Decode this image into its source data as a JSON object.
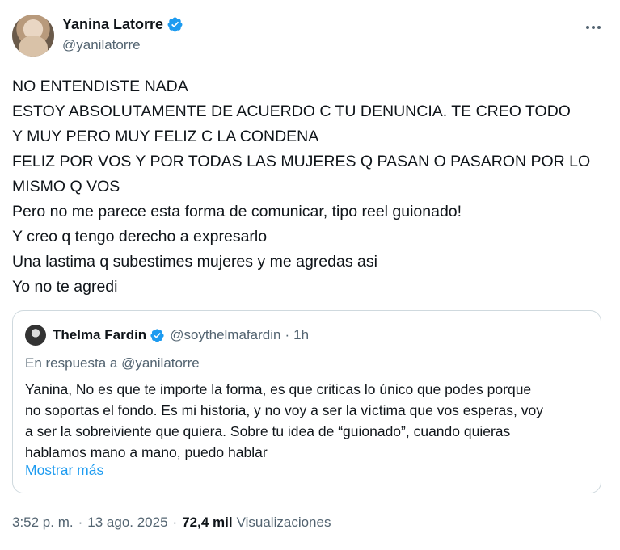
{
  "author": {
    "name": "Yanina Latorre",
    "handle": "@yanilatorre"
  },
  "tweet": {
    "lines": [
      "NO ENTENDISTE NADA",
      "ESTOY ABSOLUTAMENTE DE ACUERDO C TU DENUNCIA. TE CREO TODO",
      "Y MUY PERO MUY FELIZ C LA CONDENA",
      "FELIZ POR VOS Y POR TODAS LAS MUJERES Q PASAN O PASARON POR LO",
      "MISMO Q VOS",
      "Pero no me parece esta forma de comunicar, tipo reel guionado!",
      "Y creo q tengo derecho a expresarlo",
      "Una lastima q subestimes mujeres y me agredas asi",
      "Yo no te agredi"
    ]
  },
  "quote": {
    "name": "Thelma Fardin",
    "handle": "@soythelmafardin",
    "separator": "·",
    "time": "1h",
    "reply_prefix": "En respuesta a",
    "reply_to": "@yanilatorre",
    "lines": [
      "Yanina, No es que te importe la forma, es que criticas lo único que podes porque",
      "no soportas el fondo. Es mi historia, y no voy a ser la víctima que vos esperas, voy",
      "a ser la sobreiviente que quiera. Sobre tu idea de “guionado”, cuando quieras",
      "hablamos mano a mano, puedo hablar"
    ],
    "show_more": "Mostrar más"
  },
  "meta": {
    "time": "3:52 p. m.",
    "separator": "·",
    "date": "13 ago. 2025",
    "views_count": "72,4 mil",
    "views_label": "Visualizaciones"
  },
  "colors": {
    "verified": "#1d9bf0",
    "link": "#1d9bf0",
    "secondary_text": "#536471"
  },
  "icons": {
    "verified": "verified-badge-icon",
    "more": "more-horizontal-icon"
  }
}
